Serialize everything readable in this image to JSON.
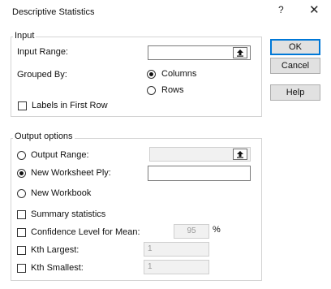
{
  "window": {
    "title": "Descriptive Statistics",
    "help_glyph": "?",
    "close_glyph": "✕"
  },
  "input": {
    "group_label": "Input",
    "input_range_label": "Input Range:",
    "input_range_value": "",
    "grouped_by_label": "Grouped By:",
    "columns_label": "Columns",
    "rows_label": "Rows",
    "grouped_by_selected": "Columns",
    "labels_first_row_label": "Labels in First Row",
    "labels_first_row_checked": false
  },
  "buttons": {
    "ok": "OK",
    "cancel": "Cancel",
    "help": "Help"
  },
  "output": {
    "group_label": "Output options",
    "output_range_label": "Output Range:",
    "output_range_value": "",
    "new_ply_label": "New Worksheet Ply:",
    "new_ply_value": "",
    "new_workbook_label": "New Workbook",
    "selected": "New Worksheet Ply",
    "summary_label": "Summary statistics",
    "confidence_label": "Confidence Level for Mean:",
    "confidence_value": "95",
    "confidence_unit": "%",
    "kth_largest_label": "Kth Largest:",
    "kth_largest_value": "1",
    "kth_smallest_label": "Kth Smallest:",
    "kth_smallest_value": "1"
  },
  "colors": {
    "default_button_border": "#0078d7",
    "button_bg": "#e1e1e1",
    "group_border": "#d4d4d4"
  },
  "icons": {
    "ref_button": "collapse-dialog-arrow-icon"
  }
}
